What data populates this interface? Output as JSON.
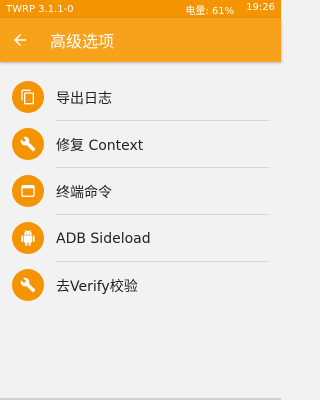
{
  "status": {
    "app": "TWRP 3.1.1-0",
    "battery": "电量:  61%",
    "time": "19:26"
  },
  "toolbar": {
    "title": "高级选项"
  },
  "items": [
    {
      "label": "导出日志",
      "icon": "copy-icon"
    },
    {
      "label": "修复 Context",
      "icon": "wrench-icon"
    },
    {
      "label": "终端命令",
      "icon": "terminal-icon"
    },
    {
      "label": "ADB Sideload",
      "icon": "android-icon"
    },
    {
      "label": "去Verify校验",
      "icon": "wrench-icon"
    }
  ],
  "colors": {
    "accent": "#f7a21a",
    "statusbar": "#f49400",
    "background": "#f2f2f2"
  }
}
